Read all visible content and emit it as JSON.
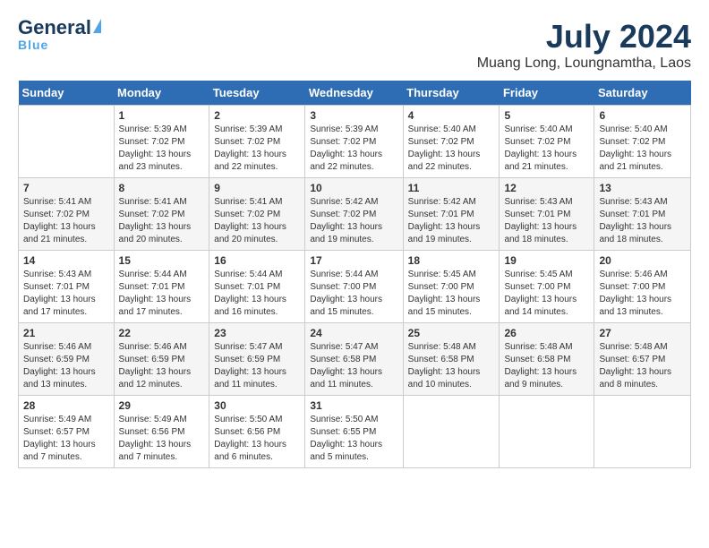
{
  "header": {
    "logo_general": "General",
    "logo_blue": "Blue",
    "month_year": "July 2024",
    "location": "Muang Long, Loungnamtha, Laos"
  },
  "weekdays": [
    "Sunday",
    "Monday",
    "Tuesday",
    "Wednesday",
    "Thursday",
    "Friday",
    "Saturday"
  ],
  "weeks": [
    [
      {
        "day": "",
        "info": ""
      },
      {
        "day": "1",
        "info": "Sunrise: 5:39 AM\nSunset: 7:02 PM\nDaylight: 13 hours\nand 23 minutes."
      },
      {
        "day": "2",
        "info": "Sunrise: 5:39 AM\nSunset: 7:02 PM\nDaylight: 13 hours\nand 22 minutes."
      },
      {
        "day": "3",
        "info": "Sunrise: 5:39 AM\nSunset: 7:02 PM\nDaylight: 13 hours\nand 22 minutes."
      },
      {
        "day": "4",
        "info": "Sunrise: 5:40 AM\nSunset: 7:02 PM\nDaylight: 13 hours\nand 22 minutes."
      },
      {
        "day": "5",
        "info": "Sunrise: 5:40 AM\nSunset: 7:02 PM\nDaylight: 13 hours\nand 21 minutes."
      },
      {
        "day": "6",
        "info": "Sunrise: 5:40 AM\nSunset: 7:02 PM\nDaylight: 13 hours\nand 21 minutes."
      }
    ],
    [
      {
        "day": "7",
        "info": "Sunrise: 5:41 AM\nSunset: 7:02 PM\nDaylight: 13 hours\nand 21 minutes."
      },
      {
        "day": "8",
        "info": "Sunrise: 5:41 AM\nSunset: 7:02 PM\nDaylight: 13 hours\nand 20 minutes."
      },
      {
        "day": "9",
        "info": "Sunrise: 5:41 AM\nSunset: 7:02 PM\nDaylight: 13 hours\nand 20 minutes."
      },
      {
        "day": "10",
        "info": "Sunrise: 5:42 AM\nSunset: 7:02 PM\nDaylight: 13 hours\nand 19 minutes."
      },
      {
        "day": "11",
        "info": "Sunrise: 5:42 AM\nSunset: 7:01 PM\nDaylight: 13 hours\nand 19 minutes."
      },
      {
        "day": "12",
        "info": "Sunrise: 5:43 AM\nSunset: 7:01 PM\nDaylight: 13 hours\nand 18 minutes."
      },
      {
        "day": "13",
        "info": "Sunrise: 5:43 AM\nSunset: 7:01 PM\nDaylight: 13 hours\nand 18 minutes."
      }
    ],
    [
      {
        "day": "14",
        "info": "Sunrise: 5:43 AM\nSunset: 7:01 PM\nDaylight: 13 hours\nand 17 minutes."
      },
      {
        "day": "15",
        "info": "Sunrise: 5:44 AM\nSunset: 7:01 PM\nDaylight: 13 hours\nand 17 minutes."
      },
      {
        "day": "16",
        "info": "Sunrise: 5:44 AM\nSunset: 7:01 PM\nDaylight: 13 hours\nand 16 minutes."
      },
      {
        "day": "17",
        "info": "Sunrise: 5:44 AM\nSunset: 7:00 PM\nDaylight: 13 hours\nand 15 minutes."
      },
      {
        "day": "18",
        "info": "Sunrise: 5:45 AM\nSunset: 7:00 PM\nDaylight: 13 hours\nand 15 minutes."
      },
      {
        "day": "19",
        "info": "Sunrise: 5:45 AM\nSunset: 7:00 PM\nDaylight: 13 hours\nand 14 minutes."
      },
      {
        "day": "20",
        "info": "Sunrise: 5:46 AM\nSunset: 7:00 PM\nDaylight: 13 hours\nand 13 minutes."
      }
    ],
    [
      {
        "day": "21",
        "info": "Sunrise: 5:46 AM\nSunset: 6:59 PM\nDaylight: 13 hours\nand 13 minutes."
      },
      {
        "day": "22",
        "info": "Sunrise: 5:46 AM\nSunset: 6:59 PM\nDaylight: 13 hours\nand 12 minutes."
      },
      {
        "day": "23",
        "info": "Sunrise: 5:47 AM\nSunset: 6:59 PM\nDaylight: 13 hours\nand 11 minutes."
      },
      {
        "day": "24",
        "info": "Sunrise: 5:47 AM\nSunset: 6:58 PM\nDaylight: 13 hours\nand 11 minutes."
      },
      {
        "day": "25",
        "info": "Sunrise: 5:48 AM\nSunset: 6:58 PM\nDaylight: 13 hours\nand 10 minutes."
      },
      {
        "day": "26",
        "info": "Sunrise: 5:48 AM\nSunset: 6:58 PM\nDaylight: 13 hours\nand 9 minutes."
      },
      {
        "day": "27",
        "info": "Sunrise: 5:48 AM\nSunset: 6:57 PM\nDaylight: 13 hours\nand 8 minutes."
      }
    ],
    [
      {
        "day": "28",
        "info": "Sunrise: 5:49 AM\nSunset: 6:57 PM\nDaylight: 13 hours\nand 7 minutes."
      },
      {
        "day": "29",
        "info": "Sunrise: 5:49 AM\nSunset: 6:56 PM\nDaylight: 13 hours\nand 7 minutes."
      },
      {
        "day": "30",
        "info": "Sunrise: 5:50 AM\nSunset: 6:56 PM\nDaylight: 13 hours\nand 6 minutes."
      },
      {
        "day": "31",
        "info": "Sunrise: 5:50 AM\nSunset: 6:55 PM\nDaylight: 13 hours\nand 5 minutes."
      },
      {
        "day": "",
        "info": ""
      },
      {
        "day": "",
        "info": ""
      },
      {
        "day": "",
        "info": ""
      }
    ]
  ]
}
